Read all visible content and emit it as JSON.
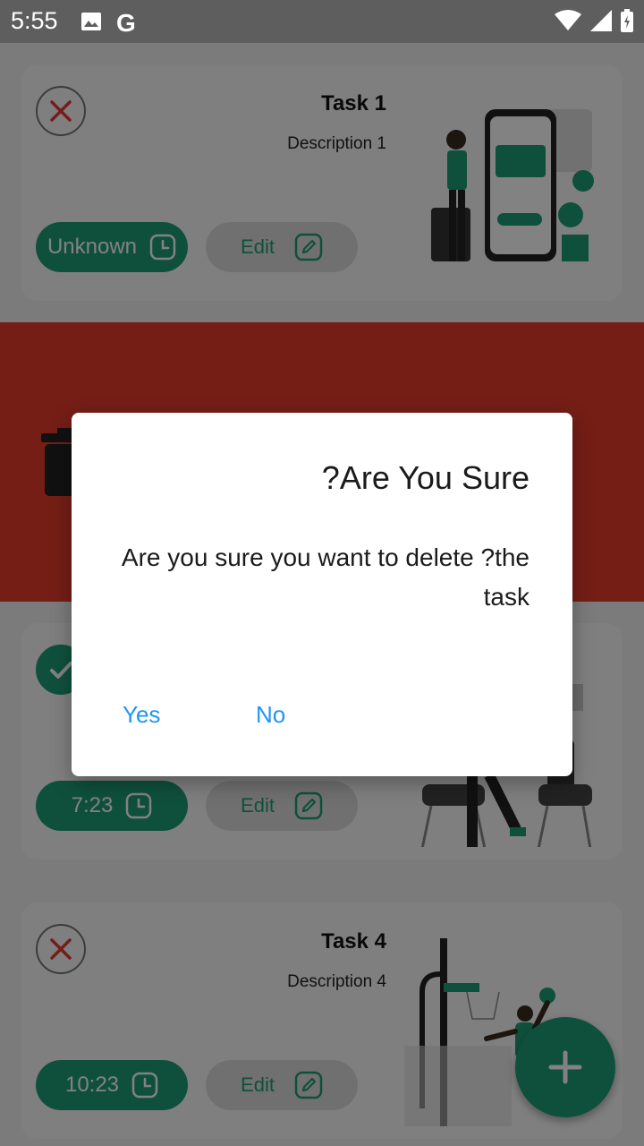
{
  "status_bar": {
    "time": "5:55",
    "g_letter": "G"
  },
  "tasks": [
    {
      "title": "Task 1",
      "description": "Description 1",
      "time_label": "Unknown",
      "edit_label": "Edit",
      "status": "incomplete"
    },
    {
      "title": "",
      "description": "",
      "time_label": "7:23",
      "edit_label": "Edit",
      "status": "done"
    },
    {
      "title": "Task 4",
      "description": "Description 4",
      "time_label": "10:23",
      "edit_label": "Edit",
      "status": "incomplete"
    }
  ],
  "dialog": {
    "title": "?Are You Sure",
    "message": "Are you sure you want to delete ?the task",
    "yes_label": "Yes",
    "no_label": "No"
  },
  "colors": {
    "accent": "#1e9d76",
    "delete_background": "#e33b2b",
    "dialog_button": "#2196f3"
  },
  "icons": [
    "image-icon",
    "wifi-icon",
    "signal-icon",
    "battery-icon",
    "close-icon",
    "check-icon",
    "clock-icon",
    "edit-icon",
    "trash-icon",
    "plus-icon"
  ]
}
